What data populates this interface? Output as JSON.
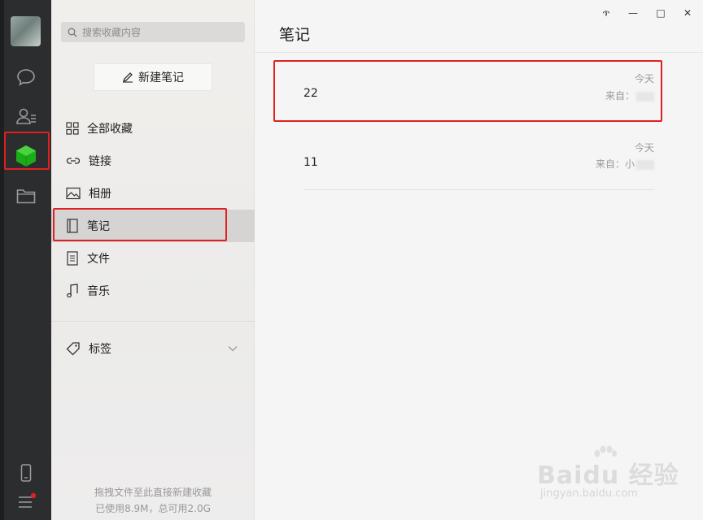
{
  "sidebar_rail": {
    "icons": [
      "chat-bubble-icon",
      "contacts-icon",
      "favorites-cube-icon",
      "folder-icon",
      "phone-icon",
      "menu-icon"
    ],
    "active_color": "#1aad19",
    "notification_color": "#e02020"
  },
  "middle": {
    "search_placeholder": "搜索收藏内容",
    "new_note_label": "新建笔记",
    "nav": [
      {
        "label": "全部收藏",
        "icon": "grid-icon"
      },
      {
        "label": "链接",
        "icon": "link-icon"
      },
      {
        "label": "相册",
        "icon": "image-icon"
      },
      {
        "label": "笔记",
        "icon": "notebook-icon"
      },
      {
        "label": "文件",
        "icon": "file-icon"
      },
      {
        "label": "音乐",
        "icon": "music-note-icon"
      }
    ],
    "tags_label": "标签",
    "footer_hint": "拖拽文件至此直接新建收藏",
    "footer_usage": "已使用8.9M，总可用2.0G"
  },
  "main": {
    "title": "笔记",
    "window_buttons": {
      "pin": "ጥ",
      "min": "—",
      "max": "□",
      "close": "✕"
    },
    "notes": [
      {
        "number": "22",
        "day": "今天",
        "from": "来自："
      },
      {
        "number": "11",
        "day": "今天",
        "from": "来自：小"
      }
    ]
  },
  "watermark": {
    "brand": "Baidu 经验",
    "site": "jingyan.baidu.com"
  },
  "colors": {
    "highlight": "#e02020",
    "rail": "#2b2d2f",
    "panel": "#f5f5f5"
  }
}
